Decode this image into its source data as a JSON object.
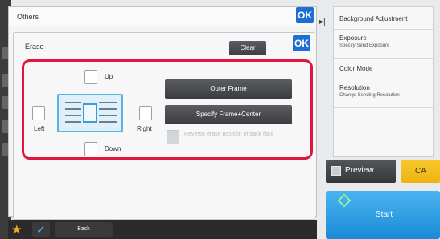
{
  "others": {
    "title": "Others",
    "ok_label": "OK"
  },
  "erase": {
    "title": "Erase",
    "ok_label": "OK",
    "clear_label": "Clear",
    "edges": {
      "up": "Up",
      "left": "Left",
      "right": "Right",
      "down": "Down"
    },
    "outer_frame_label": "Outer Frame",
    "specify_frame_label": "Specify Frame+Center",
    "reverse_label": "Reverse erase position of back face"
  },
  "right_panel": {
    "items": [
      {
        "label": "Background Adjustment",
        "sub": ""
      },
      {
        "label": "Exposure",
        "sub": "Specify Send Exposure"
      },
      {
        "label": "Color Mode",
        "sub": ""
      },
      {
        "label": "Resolution",
        "sub": "Change Sending Resolution"
      }
    ]
  },
  "actions": {
    "preview_label": "Preview",
    "ca_label": "CA",
    "start_label": "Start"
  },
  "bottom_bar": {
    "back_label": "Back"
  },
  "colors": {
    "ok_blue": "#1f6ed4",
    "highlight_red": "#e0163e",
    "ca_yellow": "#f7c82d",
    "start_blue": "#2a9ee6"
  }
}
